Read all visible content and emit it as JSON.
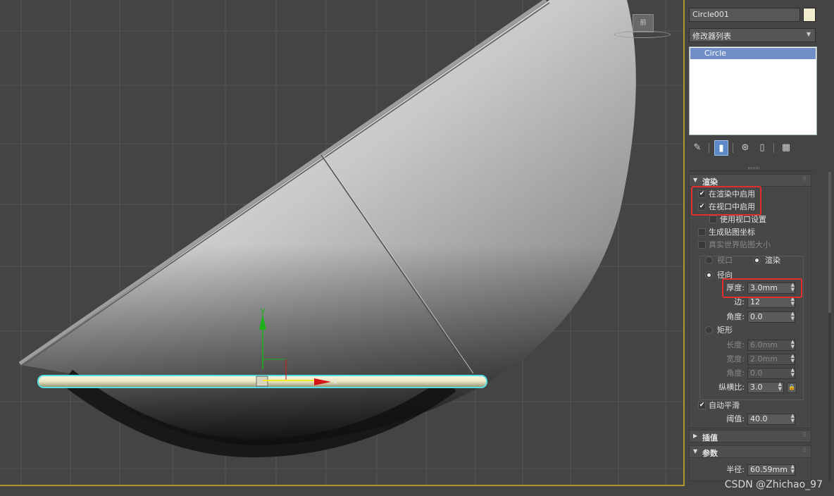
{
  "viewport": {
    "viewcube_label": "前",
    "gizmo_x_label": "x",
    "gizmo_y_label": "y",
    "colors": {
      "frame": "#b0982e",
      "selection": "#54e0e6",
      "axis_y": "#19b219",
      "axis_x": "#d41616"
    }
  },
  "panel": {
    "object_name": "Circle001",
    "object_color": "#f0edcf",
    "modifier_list_label": "修改器列表",
    "stack_items": [
      "Circle"
    ],
    "toolbar_icons": [
      "pin-icon",
      "show-end-result-icon",
      "make-unique-icon",
      "remove-modifier-icon",
      "configure-sets-icon"
    ],
    "rendering": {
      "title": "渲染",
      "enable_in_renderer": {
        "label": "在渲染中启用",
        "checked": true
      },
      "enable_in_viewport": {
        "label": "在视口中启用",
        "checked": true
      },
      "use_viewport_settings": {
        "label": "使用视口设置",
        "checked": false
      },
      "generate_mapping": {
        "label": "生成贴图坐标",
        "checked": false
      },
      "real_world_map_size": {
        "label": "真实世界贴图大小",
        "checked": false
      },
      "mode_viewport": "视口",
      "mode_render": "渲染",
      "radial": {
        "label": "径向",
        "thickness": {
          "label": "厚度:",
          "value": "3.0mm"
        },
        "sides": {
          "label": "边:",
          "value": "12"
        },
        "angle": {
          "label": "角度:",
          "value": "0.0"
        }
      },
      "rectangular": {
        "label": "矩形",
        "length": {
          "label": "长度:",
          "value": "6.0mm"
        },
        "width": {
          "label": "宽度:",
          "value": "2.0mm"
        },
        "angle": {
          "label": "角度:",
          "value": "0.0"
        },
        "aspect": {
          "label": "纵横比:",
          "value": "3.0"
        }
      },
      "auto_smooth": {
        "label": "自动平滑",
        "checked": true
      },
      "threshold": {
        "label": "阈值:",
        "value": "40.0"
      }
    },
    "interpolation": {
      "title": "插值"
    },
    "parameters": {
      "title": "参数",
      "radius": {
        "label": "半径:",
        "value": "60.59mm"
      }
    }
  },
  "watermark": "CSDN @Zhichao_97"
}
